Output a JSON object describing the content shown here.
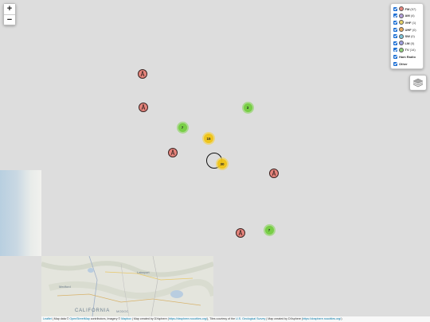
{
  "zoom": {
    "in_label": "+",
    "out_label": "−"
  },
  "legend": {
    "items": [
      {
        "label": "FM",
        "count": "(57)",
        "icon": "fm-radio-icon",
        "color": "#e6847c"
      },
      {
        "label": "AM",
        "count": "(4)",
        "icon": "am-radio-icon",
        "color": "#b4a0dc"
      },
      {
        "label": "VHF",
        "count": "(1)",
        "icon": "vhf-icon",
        "color": "#e8d46a"
      },
      {
        "label": "UHF",
        "count": "(0)",
        "icon": "uhf-icon",
        "color": "#e8a85a"
      },
      {
        "label": "SW",
        "count": "(0)",
        "icon": "sw-icon",
        "color": "#7cc4d8"
      },
      {
        "label": "LW",
        "count": "(0)",
        "icon": "lw-icon",
        "color": "#a0a0e0"
      },
      {
        "label": "TV",
        "count": "(14)",
        "icon": "tv-icon",
        "color": "#8ed07a"
      },
      {
        "label": "Ham Radio",
        "count": "",
        "icon": "",
        "color": ""
      },
      {
        "label": "Other",
        "count": "",
        "icon": "",
        "color": ""
      }
    ]
  },
  "clusters": [
    {
      "count": "3",
      "color": "green"
    },
    {
      "count": "7",
      "color": "green"
    },
    {
      "count": "15",
      "color": "yellow"
    },
    {
      "count": "30",
      "color": "yellow"
    },
    {
      "count": "7",
      "color": "green"
    }
  ],
  "map_labels": {
    "california": "CALIFORNIA",
    "lakeport": "Lakeport",
    "medford": "Medford",
    "modoc": "MODOC"
  },
  "attribution": {
    "leaflet": "Leaflet",
    "text1": " | Map data © ",
    "osm": "OpenStreetMap",
    "text2": " contributors, Imagery © ",
    "mapbox": "Mapbox",
    "text3": " | Map created by DXsphere (",
    "dx_url1": "https://dxsphere.nocotties.org/",
    "text4": "), Tiles courtesy of the ",
    "usgs": "U.S. Geological Survey",
    "text5": " | Map created by DXsphere (",
    "dx_url2": "https://dxsphere.nocotties.org/",
    "text6": ")"
  }
}
